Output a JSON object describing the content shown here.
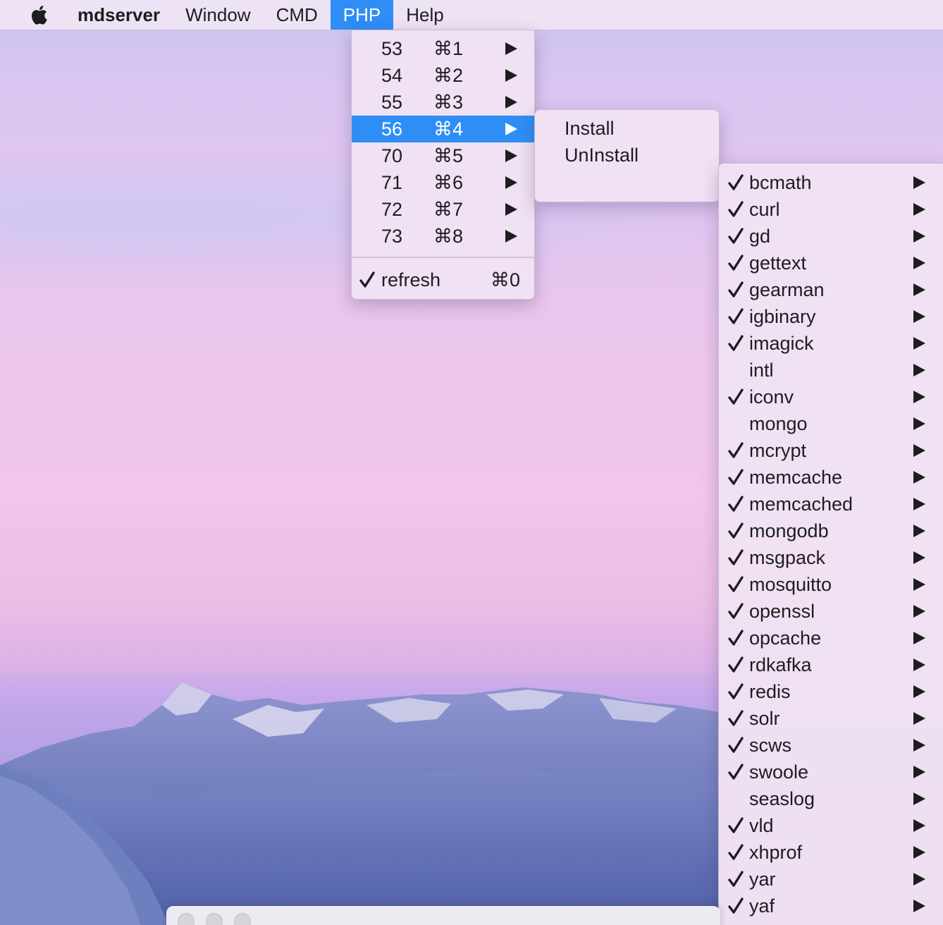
{
  "menubar": {
    "apple_icon": "apple-icon",
    "app_name": "mdserver",
    "items": [
      {
        "label": "Window"
      },
      {
        "label": "CMD"
      },
      {
        "label": "PHP"
      },
      {
        "label": "Help"
      }
    ],
    "active_item": "PHP",
    "accent_color": "#2f8ef6"
  },
  "php_menu": {
    "versions": [
      {
        "label": "53",
        "shortcut": "⌘1"
      },
      {
        "label": "54",
        "shortcut": "⌘2"
      },
      {
        "label": "55",
        "shortcut": "⌘3"
      },
      {
        "label": "56",
        "shortcut": "⌘4"
      },
      {
        "label": "70",
        "shortcut": "⌘5"
      },
      {
        "label": "71",
        "shortcut": "⌘6"
      },
      {
        "label": "72",
        "shortcut": "⌘7"
      },
      {
        "label": "73",
        "shortcut": "⌘8"
      }
    ],
    "highlighted": "56",
    "refresh": {
      "label": "refresh",
      "shortcut": "⌘0",
      "checked": true
    }
  },
  "version_submenu": {
    "items": [
      {
        "label": "Install"
      },
      {
        "label": "UnInstall"
      }
    ]
  },
  "extensions_submenu": {
    "items": [
      {
        "label": "bcmath",
        "checked": true
      },
      {
        "label": "curl",
        "checked": true
      },
      {
        "label": "gd",
        "checked": true
      },
      {
        "label": "gettext",
        "checked": true
      },
      {
        "label": "gearman",
        "checked": true
      },
      {
        "label": "igbinary",
        "checked": true
      },
      {
        "label": "imagick",
        "checked": true
      },
      {
        "label": "intl",
        "checked": false
      },
      {
        "label": "iconv",
        "checked": true
      },
      {
        "label": "mongo",
        "checked": false
      },
      {
        "label": "mcrypt",
        "checked": true
      },
      {
        "label": "memcache",
        "checked": true
      },
      {
        "label": "memcached",
        "checked": true
      },
      {
        "label": "mongodb",
        "checked": true
      },
      {
        "label": "msgpack",
        "checked": true
      },
      {
        "label": "mosquitto",
        "checked": true
      },
      {
        "label": "openssl",
        "checked": true
      },
      {
        "label": "opcache",
        "checked": true
      },
      {
        "label": "rdkafka",
        "checked": true
      },
      {
        "label": "redis",
        "checked": true
      },
      {
        "label": "solr",
        "checked": true
      },
      {
        "label": "scws",
        "checked": true
      },
      {
        "label": "swoole",
        "checked": true
      },
      {
        "label": "seaslog",
        "checked": false
      },
      {
        "label": "vld",
        "checked": true
      },
      {
        "label": "xhprof",
        "checked": true
      },
      {
        "label": "yar",
        "checked": true
      },
      {
        "label": "yaf",
        "checked": true
      }
    ]
  }
}
